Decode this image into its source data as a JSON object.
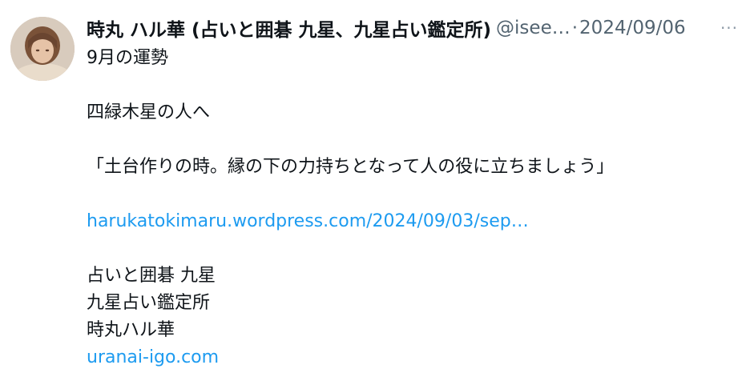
{
  "tweet": {
    "display_name": "時丸 ハル華 (占いと囲碁 九星、九星占い鑑定所)",
    "handle": "@isee…",
    "separator": "·",
    "date": "2024/09/06",
    "more_icon": "more-options-icon",
    "more_glyph": "···",
    "avatar_icon": "profile-avatar",
    "lines": {
      "l1": "9月の運勢",
      "l2": "四緑木星の人へ",
      "l3": "「土台作りの時。縁の下の力持ちとなって人の役に立ちましょう」",
      "link1": "harukatokimaru.wordpress.com/2024/09/03/sep…",
      "l4": "占いと囲碁 九星",
      "l5": "九星占い鑑定所",
      "l6": "時丸ハル華",
      "link2": "uranai-igo.com"
    },
    "colors": {
      "text": "#0f1419",
      "secondary": "#536471",
      "link": "#1d9bf0"
    }
  }
}
